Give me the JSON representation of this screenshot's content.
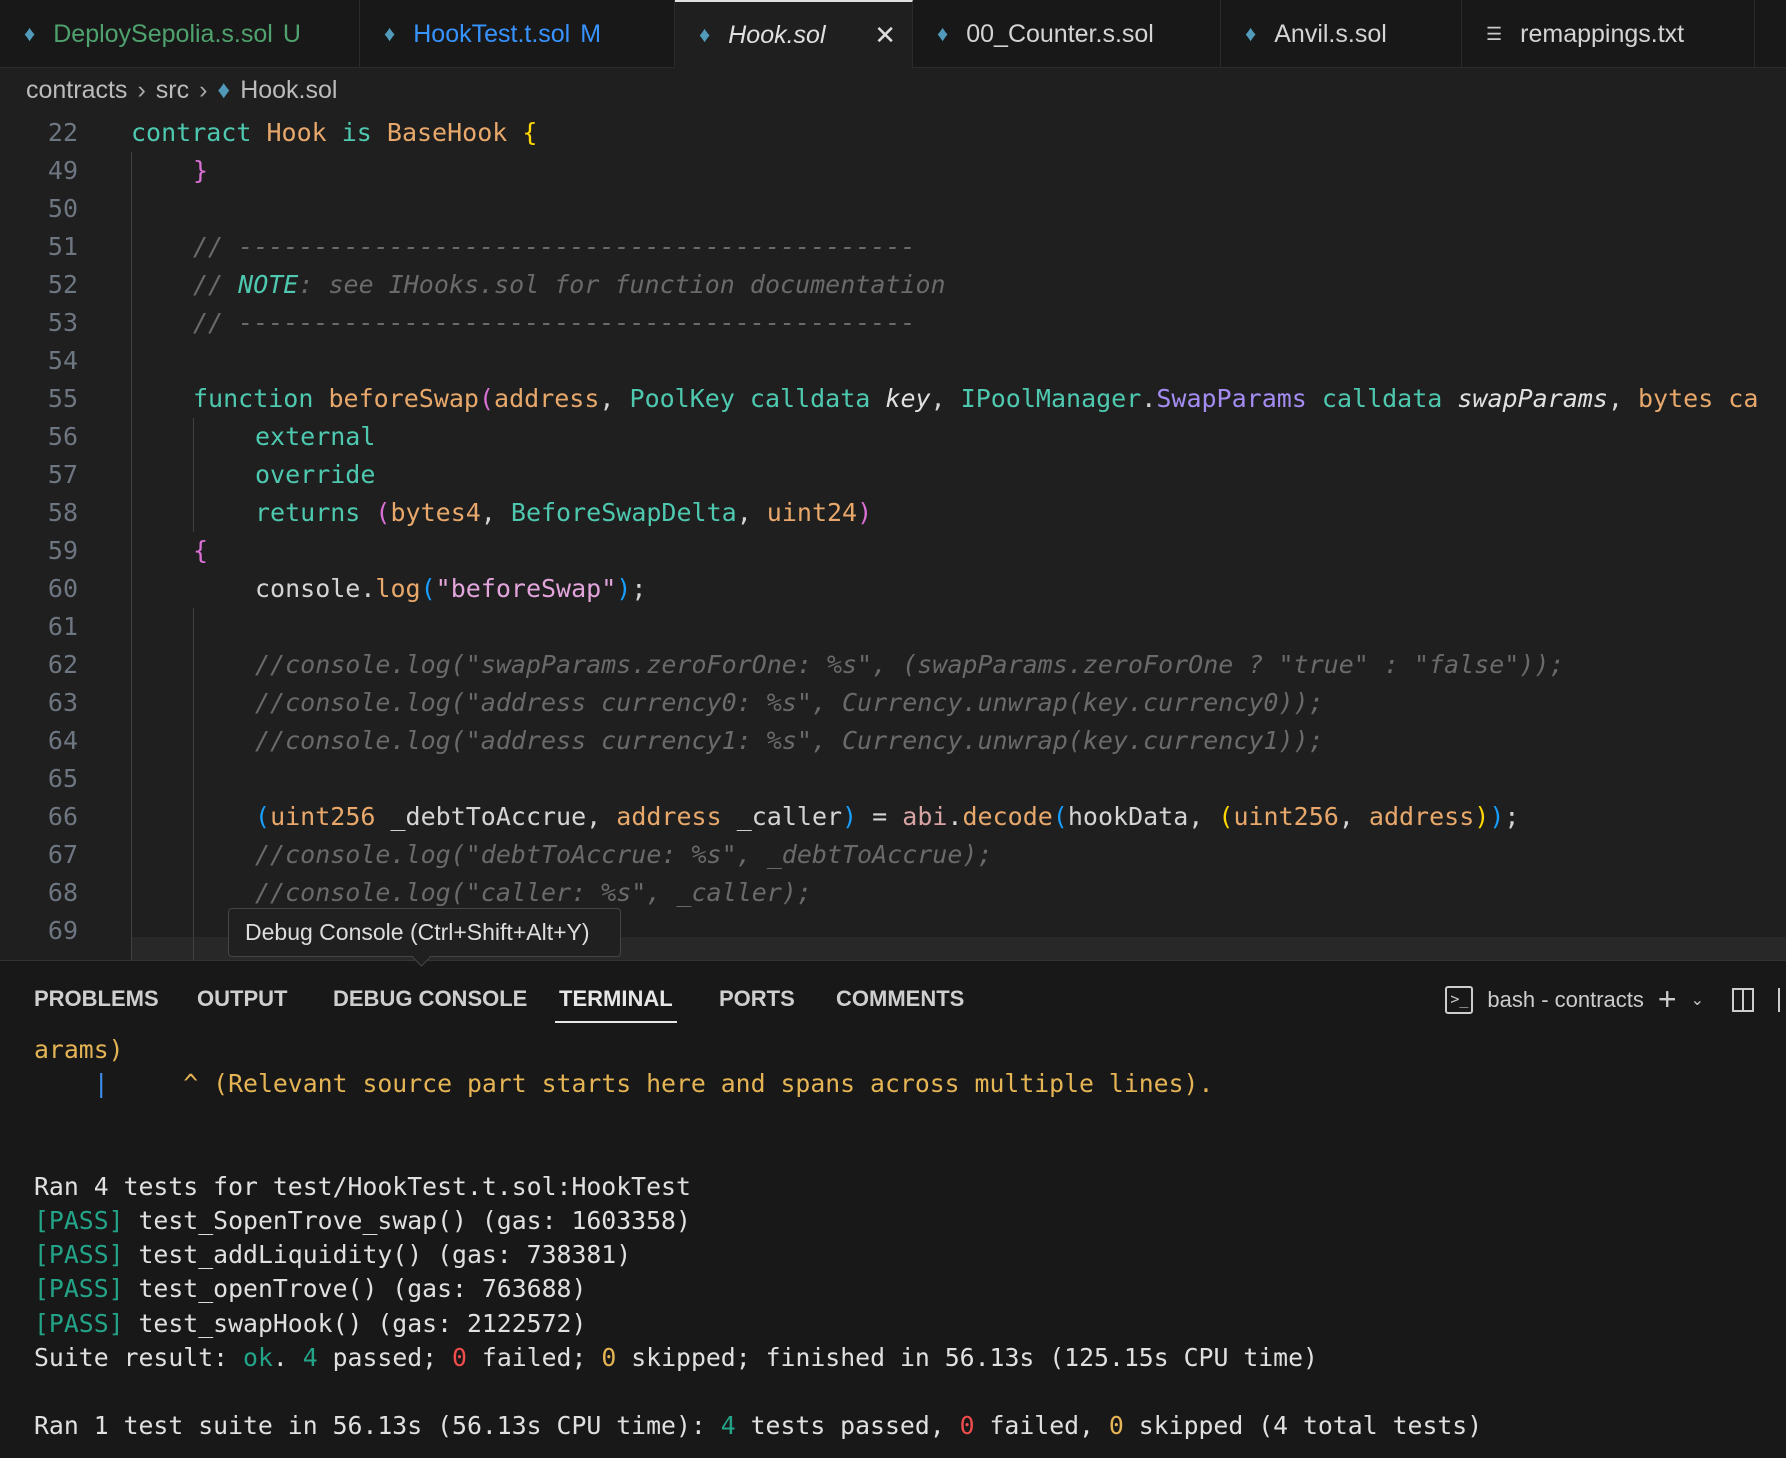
{
  "tabs": [
    {
      "label": "DeploySepolia.s.sol",
      "badge": "U",
      "color": "#4fa26e",
      "icon": "ethereum-icon"
    },
    {
      "label": "HookTest.t.sol",
      "badge": "M",
      "color": "#3794ff",
      "icon": "ethereum-icon"
    },
    {
      "label": "Hook.sol",
      "badge": "",
      "color": "#e0e0e0",
      "icon": "ethereum-icon",
      "active": true
    },
    {
      "label": "00_Counter.s.sol",
      "badge": "",
      "color": "#d4d4d4",
      "icon": "ethereum-icon"
    },
    {
      "label": "Anvil.s.sol",
      "badge": "",
      "color": "#d4d4d4",
      "icon": "ethereum-icon"
    },
    {
      "label": "remappings.txt",
      "badge": "",
      "color": "#d4d4d4",
      "icon": "text-file-icon"
    }
  ],
  "breadcrumb": [
    "contracts",
    "src",
    "Hook.sol"
  ],
  "code": [
    {
      "n": "22",
      "i": 0,
      "t": [
        [
          "contract ",
          "kw"
        ],
        [
          "Hook ",
          "nm"
        ],
        [
          "is ",
          "kw"
        ],
        [
          "BaseHook ",
          "nm"
        ],
        [
          "{",
          "y"
        ]
      ]
    },
    {
      "n": "49",
      "i": 1,
      "t": [
        [
          "}",
          "p"
        ]
      ]
    },
    {
      "n": "50",
      "i": 0,
      "t": []
    },
    {
      "n": "51",
      "i": 1,
      "t": [
        [
          "// ---------------------------------------------",
          "c"
        ]
      ]
    },
    {
      "n": "52",
      "i": 1,
      "t": [
        [
          "// ",
          "c"
        ],
        [
          "NOTE",
          "ct"
        ],
        [
          ": see IHooks.sol for function documentation",
          "c"
        ]
      ]
    },
    {
      "n": "53",
      "i": 1,
      "t": [
        [
          "// ---------------------------------------------",
          "c"
        ]
      ]
    },
    {
      "n": "54",
      "i": 0,
      "t": []
    },
    {
      "n": "55",
      "i": 1,
      "t": [
        [
          "function ",
          "kw"
        ],
        [
          "beforeSwap",
          "nm"
        ],
        [
          "(",
          "p"
        ],
        [
          "address",
          "nm"
        ],
        [
          ", ",
          "t"
        ],
        [
          "PoolKey calldata ",
          "kw"
        ],
        [
          "key",
          "it"
        ],
        [
          ", ",
          "t"
        ],
        [
          "IPoolManager",
          "kw"
        ],
        [
          ".",
          "t"
        ],
        [
          "SwapParams",
          "pu"
        ],
        [
          " calldata ",
          "kw"
        ],
        [
          "swapParams",
          "it"
        ],
        [
          ", ",
          "t"
        ],
        [
          "bytes ca",
          "nm"
        ]
      ]
    },
    {
      "n": "56",
      "i": 2,
      "t": [
        [
          "external",
          "kw"
        ]
      ]
    },
    {
      "n": "57",
      "i": 2,
      "t": [
        [
          "override",
          "kw"
        ]
      ]
    },
    {
      "n": "58",
      "i": 2,
      "t": [
        [
          "returns ",
          "kw"
        ],
        [
          "(",
          "p"
        ],
        [
          "bytes4",
          "nm"
        ],
        [
          ", ",
          "t"
        ],
        [
          "BeforeSwapDelta",
          "kw"
        ],
        [
          ", ",
          "t"
        ],
        [
          "uint24",
          "nm"
        ],
        [
          ")",
          "p"
        ]
      ]
    },
    {
      "n": "59",
      "i": 1,
      "t": [
        [
          "{",
          "p"
        ]
      ]
    },
    {
      "n": "60",
      "i": 2,
      "t": [
        [
          "console.",
          "t"
        ],
        [
          "log",
          "nm"
        ],
        [
          "(",
          "b"
        ],
        [
          "\"beforeSwap\"",
          "s"
        ],
        [
          ")",
          "b"
        ],
        [
          ";",
          "t"
        ]
      ]
    },
    {
      "n": "61",
      "i": 0,
      "t": []
    },
    {
      "n": "62",
      "i": 2,
      "t": [
        [
          "//console.log(\"swapParams.zeroForOne: %s\", (swapParams.zeroForOne ? \"true\" : \"false\"));",
          "c"
        ]
      ]
    },
    {
      "n": "63",
      "i": 2,
      "t": [
        [
          "//console.log(\"address currency0: %s\", Currency.unwrap(key.currency0));",
          "c"
        ]
      ]
    },
    {
      "n": "64",
      "i": 2,
      "t": [
        [
          "//console.log(\"address currency1: %s\", Currency.unwrap(key.currency1));",
          "c"
        ]
      ]
    },
    {
      "n": "65",
      "i": 0,
      "t": []
    },
    {
      "n": "66",
      "i": 2,
      "t": [
        [
          "(",
          "b"
        ],
        [
          "uint256 ",
          "nm"
        ],
        [
          "_debtToAccrue, ",
          "t"
        ],
        [
          "address ",
          "nm"
        ],
        [
          "_caller",
          "t"
        ],
        [
          ")",
          "b"
        ],
        [
          " = ",
          "t"
        ],
        [
          "abi",
          "ab"
        ],
        [
          ".",
          "t"
        ],
        [
          "decode",
          "nm"
        ],
        [
          "(",
          "b"
        ],
        [
          "hookData, ",
          "t"
        ],
        [
          "(",
          "y"
        ],
        [
          "uint256",
          "nm"
        ],
        [
          ", ",
          "t"
        ],
        [
          "address",
          "nm"
        ],
        [
          ")",
          "y"
        ],
        [
          ")",
          "b"
        ],
        [
          ";",
          "t"
        ]
      ]
    },
    {
      "n": "67",
      "i": 2,
      "t": [
        [
          "//console.log(\"debtToAccrue: %s\", _debtToAccrue);",
          "c"
        ]
      ]
    },
    {
      "n": "68",
      "i": 2,
      "t": [
        [
          "//console.log(\"caller: %s\", _caller);",
          "c"
        ]
      ]
    },
    {
      "n": "69",
      "i": 0,
      "t": []
    }
  ],
  "tooltip": "Debug Console (Ctrl+Shift+Alt+Y)",
  "panel": {
    "tabs": [
      "PROBLEMS",
      "OUTPUT",
      "DEBUG CONSOLE",
      "TERMINAL",
      "PORTS",
      "COMMENTS"
    ],
    "active": "TERMINAL",
    "terminal_name": "bash - contracts",
    "terminal_icon": "terminal-icon"
  },
  "terminal": [
    [
      [
        "arams)",
        "o"
      ]
    ],
    [
      [
        "    ",
        "w"
      ],
      [
        "|",
        "bl"
      ],
      [
        "     ^ (Relevant source part starts here and spans across multiple lines).",
        "o"
      ]
    ],
    [],
    [],
    [
      [
        "Ran 4 tests for test/HookTest.t.sol:HookTest",
        "w"
      ]
    ],
    [
      [
        "[PASS]",
        "g"
      ],
      [
        " test_SopenTrove_swap() (gas: 1603358)",
        "w"
      ]
    ],
    [
      [
        "[PASS]",
        "g"
      ],
      [
        " test_addLiquidity() (gas: 738381)",
        "w"
      ]
    ],
    [
      [
        "[PASS]",
        "g"
      ],
      [
        " test_openTrove() (gas: 763688)",
        "w"
      ]
    ],
    [
      [
        "[PASS]",
        "g"
      ],
      [
        " test_swapHook() (gas: 2122572)",
        "w"
      ]
    ],
    [
      [
        "Suite result: ",
        "w"
      ],
      [
        "ok",
        "g"
      ],
      [
        ". ",
        "w"
      ],
      [
        "4",
        "g"
      ],
      [
        " passed; ",
        "w"
      ],
      [
        "0",
        "r"
      ],
      [
        " failed; ",
        "w"
      ],
      [
        "0",
        "o"
      ],
      [
        " skipped; finished in 56.13s (125.15s CPU time)",
        "w"
      ]
    ],
    [],
    [
      [
        "Ran 1 test suite in 56.13s (56.13s CPU time): ",
        "w"
      ],
      [
        "4",
        "g"
      ],
      [
        " tests passed, ",
        "w"
      ],
      [
        "0",
        "r"
      ],
      [
        " failed, ",
        "w"
      ],
      [
        "0",
        "o"
      ],
      [
        " skipped (4 total tests)",
        "w"
      ]
    ]
  ]
}
